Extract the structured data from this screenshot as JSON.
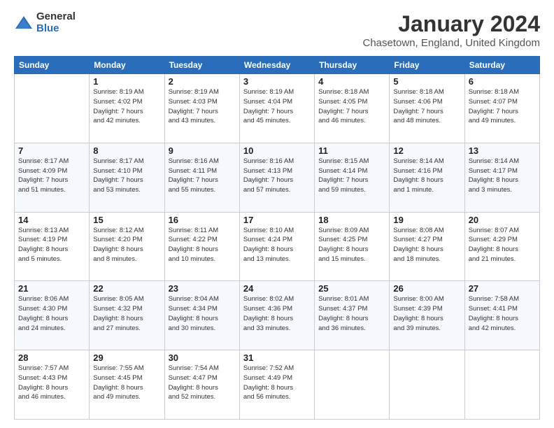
{
  "header": {
    "logo_general": "General",
    "logo_blue": "Blue",
    "month_year": "January 2024",
    "location": "Chasetown, England, United Kingdom"
  },
  "days_of_week": [
    "Sunday",
    "Monday",
    "Tuesday",
    "Wednesday",
    "Thursday",
    "Friday",
    "Saturday"
  ],
  "weeks": [
    [
      {
        "day": "",
        "info": ""
      },
      {
        "day": "1",
        "info": "Sunrise: 8:19 AM\nSunset: 4:02 PM\nDaylight: 7 hours\nand 42 minutes."
      },
      {
        "day": "2",
        "info": "Sunrise: 8:19 AM\nSunset: 4:03 PM\nDaylight: 7 hours\nand 43 minutes."
      },
      {
        "day": "3",
        "info": "Sunrise: 8:19 AM\nSunset: 4:04 PM\nDaylight: 7 hours\nand 45 minutes."
      },
      {
        "day": "4",
        "info": "Sunrise: 8:18 AM\nSunset: 4:05 PM\nDaylight: 7 hours\nand 46 minutes."
      },
      {
        "day": "5",
        "info": "Sunrise: 8:18 AM\nSunset: 4:06 PM\nDaylight: 7 hours\nand 48 minutes."
      },
      {
        "day": "6",
        "info": "Sunrise: 8:18 AM\nSunset: 4:07 PM\nDaylight: 7 hours\nand 49 minutes."
      }
    ],
    [
      {
        "day": "7",
        "info": "Sunrise: 8:17 AM\nSunset: 4:09 PM\nDaylight: 7 hours\nand 51 minutes."
      },
      {
        "day": "8",
        "info": "Sunrise: 8:17 AM\nSunset: 4:10 PM\nDaylight: 7 hours\nand 53 minutes."
      },
      {
        "day": "9",
        "info": "Sunrise: 8:16 AM\nSunset: 4:11 PM\nDaylight: 7 hours\nand 55 minutes."
      },
      {
        "day": "10",
        "info": "Sunrise: 8:16 AM\nSunset: 4:13 PM\nDaylight: 7 hours\nand 57 minutes."
      },
      {
        "day": "11",
        "info": "Sunrise: 8:15 AM\nSunset: 4:14 PM\nDaylight: 7 hours\nand 59 minutes."
      },
      {
        "day": "12",
        "info": "Sunrise: 8:14 AM\nSunset: 4:16 PM\nDaylight: 8 hours\nand 1 minute."
      },
      {
        "day": "13",
        "info": "Sunrise: 8:14 AM\nSunset: 4:17 PM\nDaylight: 8 hours\nand 3 minutes."
      }
    ],
    [
      {
        "day": "14",
        "info": "Sunrise: 8:13 AM\nSunset: 4:19 PM\nDaylight: 8 hours\nand 5 minutes."
      },
      {
        "day": "15",
        "info": "Sunrise: 8:12 AM\nSunset: 4:20 PM\nDaylight: 8 hours\nand 8 minutes."
      },
      {
        "day": "16",
        "info": "Sunrise: 8:11 AM\nSunset: 4:22 PM\nDaylight: 8 hours\nand 10 minutes."
      },
      {
        "day": "17",
        "info": "Sunrise: 8:10 AM\nSunset: 4:24 PM\nDaylight: 8 hours\nand 13 minutes."
      },
      {
        "day": "18",
        "info": "Sunrise: 8:09 AM\nSunset: 4:25 PM\nDaylight: 8 hours\nand 15 minutes."
      },
      {
        "day": "19",
        "info": "Sunrise: 8:08 AM\nSunset: 4:27 PM\nDaylight: 8 hours\nand 18 minutes."
      },
      {
        "day": "20",
        "info": "Sunrise: 8:07 AM\nSunset: 4:29 PM\nDaylight: 8 hours\nand 21 minutes."
      }
    ],
    [
      {
        "day": "21",
        "info": "Sunrise: 8:06 AM\nSunset: 4:30 PM\nDaylight: 8 hours\nand 24 minutes."
      },
      {
        "day": "22",
        "info": "Sunrise: 8:05 AM\nSunset: 4:32 PM\nDaylight: 8 hours\nand 27 minutes."
      },
      {
        "day": "23",
        "info": "Sunrise: 8:04 AM\nSunset: 4:34 PM\nDaylight: 8 hours\nand 30 minutes."
      },
      {
        "day": "24",
        "info": "Sunrise: 8:02 AM\nSunset: 4:36 PM\nDaylight: 8 hours\nand 33 minutes."
      },
      {
        "day": "25",
        "info": "Sunrise: 8:01 AM\nSunset: 4:37 PM\nDaylight: 8 hours\nand 36 minutes."
      },
      {
        "day": "26",
        "info": "Sunrise: 8:00 AM\nSunset: 4:39 PM\nDaylight: 8 hours\nand 39 minutes."
      },
      {
        "day": "27",
        "info": "Sunrise: 7:58 AM\nSunset: 4:41 PM\nDaylight: 8 hours\nand 42 minutes."
      }
    ],
    [
      {
        "day": "28",
        "info": "Sunrise: 7:57 AM\nSunset: 4:43 PM\nDaylight: 8 hours\nand 46 minutes."
      },
      {
        "day": "29",
        "info": "Sunrise: 7:55 AM\nSunset: 4:45 PM\nDaylight: 8 hours\nand 49 minutes."
      },
      {
        "day": "30",
        "info": "Sunrise: 7:54 AM\nSunset: 4:47 PM\nDaylight: 8 hours\nand 52 minutes."
      },
      {
        "day": "31",
        "info": "Sunrise: 7:52 AM\nSunset: 4:49 PM\nDaylight: 8 hours\nand 56 minutes."
      },
      {
        "day": "",
        "info": ""
      },
      {
        "day": "",
        "info": ""
      },
      {
        "day": "",
        "info": ""
      }
    ]
  ]
}
